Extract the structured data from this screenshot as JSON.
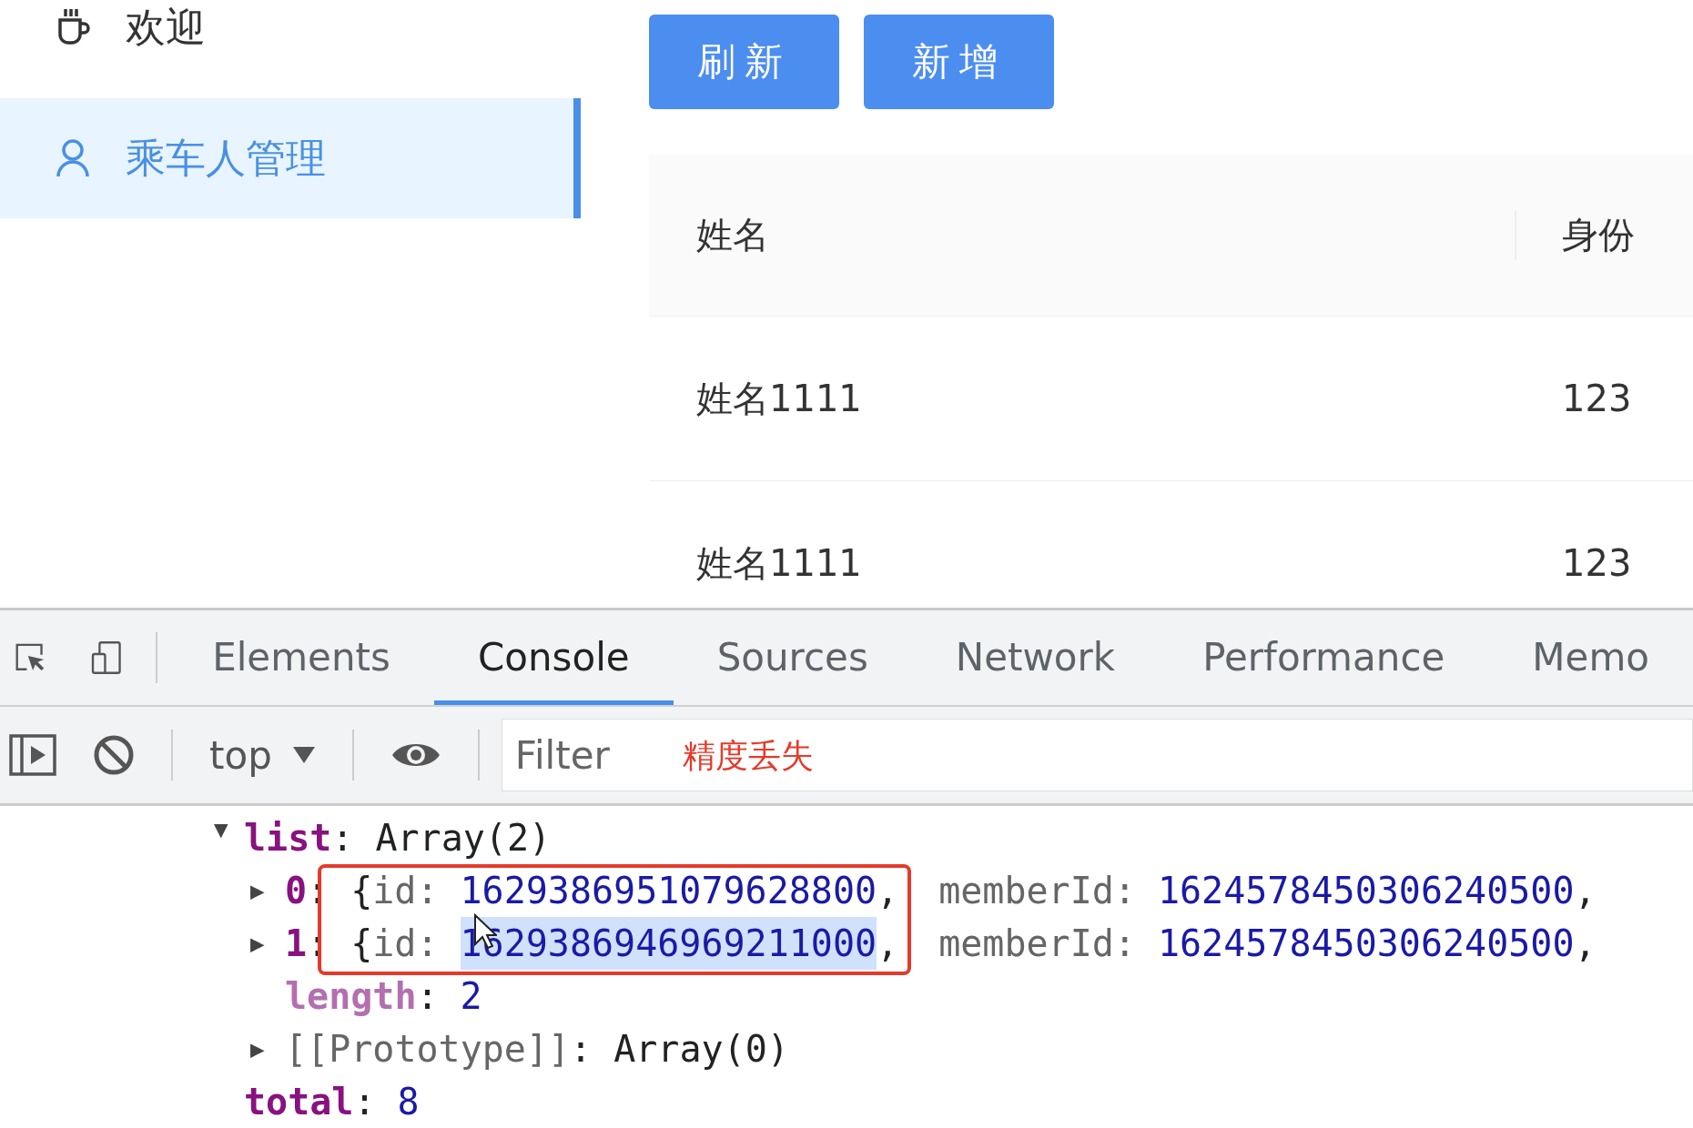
{
  "sidebar": {
    "items": [
      {
        "label": "欢迎",
        "selected": false
      },
      {
        "label": "乘车人管理",
        "selected": true
      }
    ]
  },
  "toolbar": {
    "buttons": [
      "刷新",
      "新增"
    ]
  },
  "table": {
    "columns": [
      "姓名",
      "身份"
    ],
    "rows": [
      [
        "姓名1111",
        "123"
      ],
      [
        "姓名1111",
        "123"
      ]
    ]
  },
  "devtools": {
    "tabs": [
      {
        "label": "Elements",
        "selected": false
      },
      {
        "label": "Console",
        "selected": true
      },
      {
        "label": "Sources",
        "selected": false
      },
      {
        "label": "Network",
        "selected": false
      },
      {
        "label": "Performance",
        "selected": false
      },
      {
        "label": "Memo",
        "selected": false
      }
    ],
    "context": "top",
    "filter": {
      "placeholder": "Filter"
    },
    "annotation": "精度丢失",
    "console": [
      {
        "key": "list",
        "colon": ":",
        "kind": "array",
        "toggle": "▶",
        "value": "Array(2)",
        "expanded": true,
        "children": [
          {
            "key": "0",
            "colon": ":",
            "kind": "object",
            "toggle": "▶",
            "expanded": false,
            "framed": true,
            "open": "{",
            "fields": [
              {
                "name": "id:",
                "value": "1629386951079628800",
                "after": ",",
                "highlighted": false
              },
              {
                "name": "memberId:",
                "value": "1624578450306240500",
                "after": ",",
                "highlighted": false
              }
            ]
          },
          {
            "key": "1",
            "colon": ":",
            "kind": "object",
            "toggle": "▶",
            "expanded": false,
            "framed": true,
            "open": "{",
            "fields": [
              {
                "name": "id:",
                "value": "1629386946969211000",
                "after": ",",
                "highlighted": true
              },
              {
                "name": "memberId:",
                "value": "1624578450306240500",
                "after": ",",
                "highlighted": false
              }
            ]
          },
          {
            "key": "length",
            "colon": ":",
            "kind": "number",
            "value": "2"
          },
          {
            "key": "[[Prototype]]",
            "colon": ":",
            "kind": "prototype",
            "toggle": "▶",
            "value": "Array(0)",
            "expanded": false
          }
        ]
      },
      {
        "key": "total",
        "colon": ":",
        "kind": "number",
        "value": "8"
      }
    ]
  }
}
